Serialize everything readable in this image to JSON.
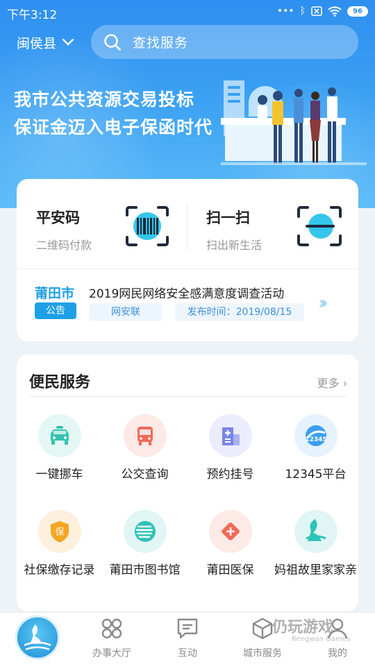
{
  "status_bar": {
    "time": "下午3:12",
    "dots": "•••",
    "bluetooth": "ᛒ",
    "battery": "96"
  },
  "header": {
    "city": "闽侯县",
    "search_placeholder": "查找服务"
  },
  "banner": {
    "line1": "我市公共资源交易投标",
    "line2": "保证金迈入电子保函时代"
  },
  "quick_actions": [
    {
      "title": "平安码",
      "subtitle": "二维码付款"
    },
    {
      "title": "扫一扫",
      "subtitle": "扫出新生活"
    }
  ],
  "notice": {
    "city_logo": "莆田市",
    "tag": "公告",
    "title": "2019网民网络安全感满意度调查活动",
    "source": "网安联",
    "publish_time": "发布时间：2019/08/15",
    "arrows": "›››"
  },
  "services": {
    "title": "便民服务",
    "more": "更多",
    "items": [
      {
        "label": "一键挪车",
        "icon": "car-icon",
        "color": "#33c4b0"
      },
      {
        "label": "公交查询",
        "icon": "bus-icon",
        "color": "#f26a5a"
      },
      {
        "label": "预约挂号",
        "icon": "hospital-icon",
        "color": "#7a86e8"
      },
      {
        "label": "12345平台",
        "icon": "hotline-icon",
        "color": "#3b9ff0"
      },
      {
        "label": "社保缴存记录",
        "icon": "shield-icon",
        "color": "#f5a623"
      },
      {
        "label": "莆田市图书馆",
        "icon": "library-icon",
        "color": "#2ec3b8"
      },
      {
        "label": "莆田医保",
        "icon": "medical-icon",
        "color": "#f26a5a"
      },
      {
        "label": "妈祖故里家家亲",
        "icon": "mazu-icon",
        "color": "#2ec3b8"
      }
    ]
  },
  "bottom_nav": [
    {
      "label": "办事大厅",
      "icon": "grid-icon"
    },
    {
      "label": "互动",
      "icon": "chat-icon"
    },
    {
      "label": "城市服务",
      "icon": "cube-icon"
    },
    {
      "label": "我的",
      "icon": "user-icon"
    }
  ],
  "watermark": {
    "main": "仍玩游戏",
    "sub": "Rengwan Games"
  }
}
